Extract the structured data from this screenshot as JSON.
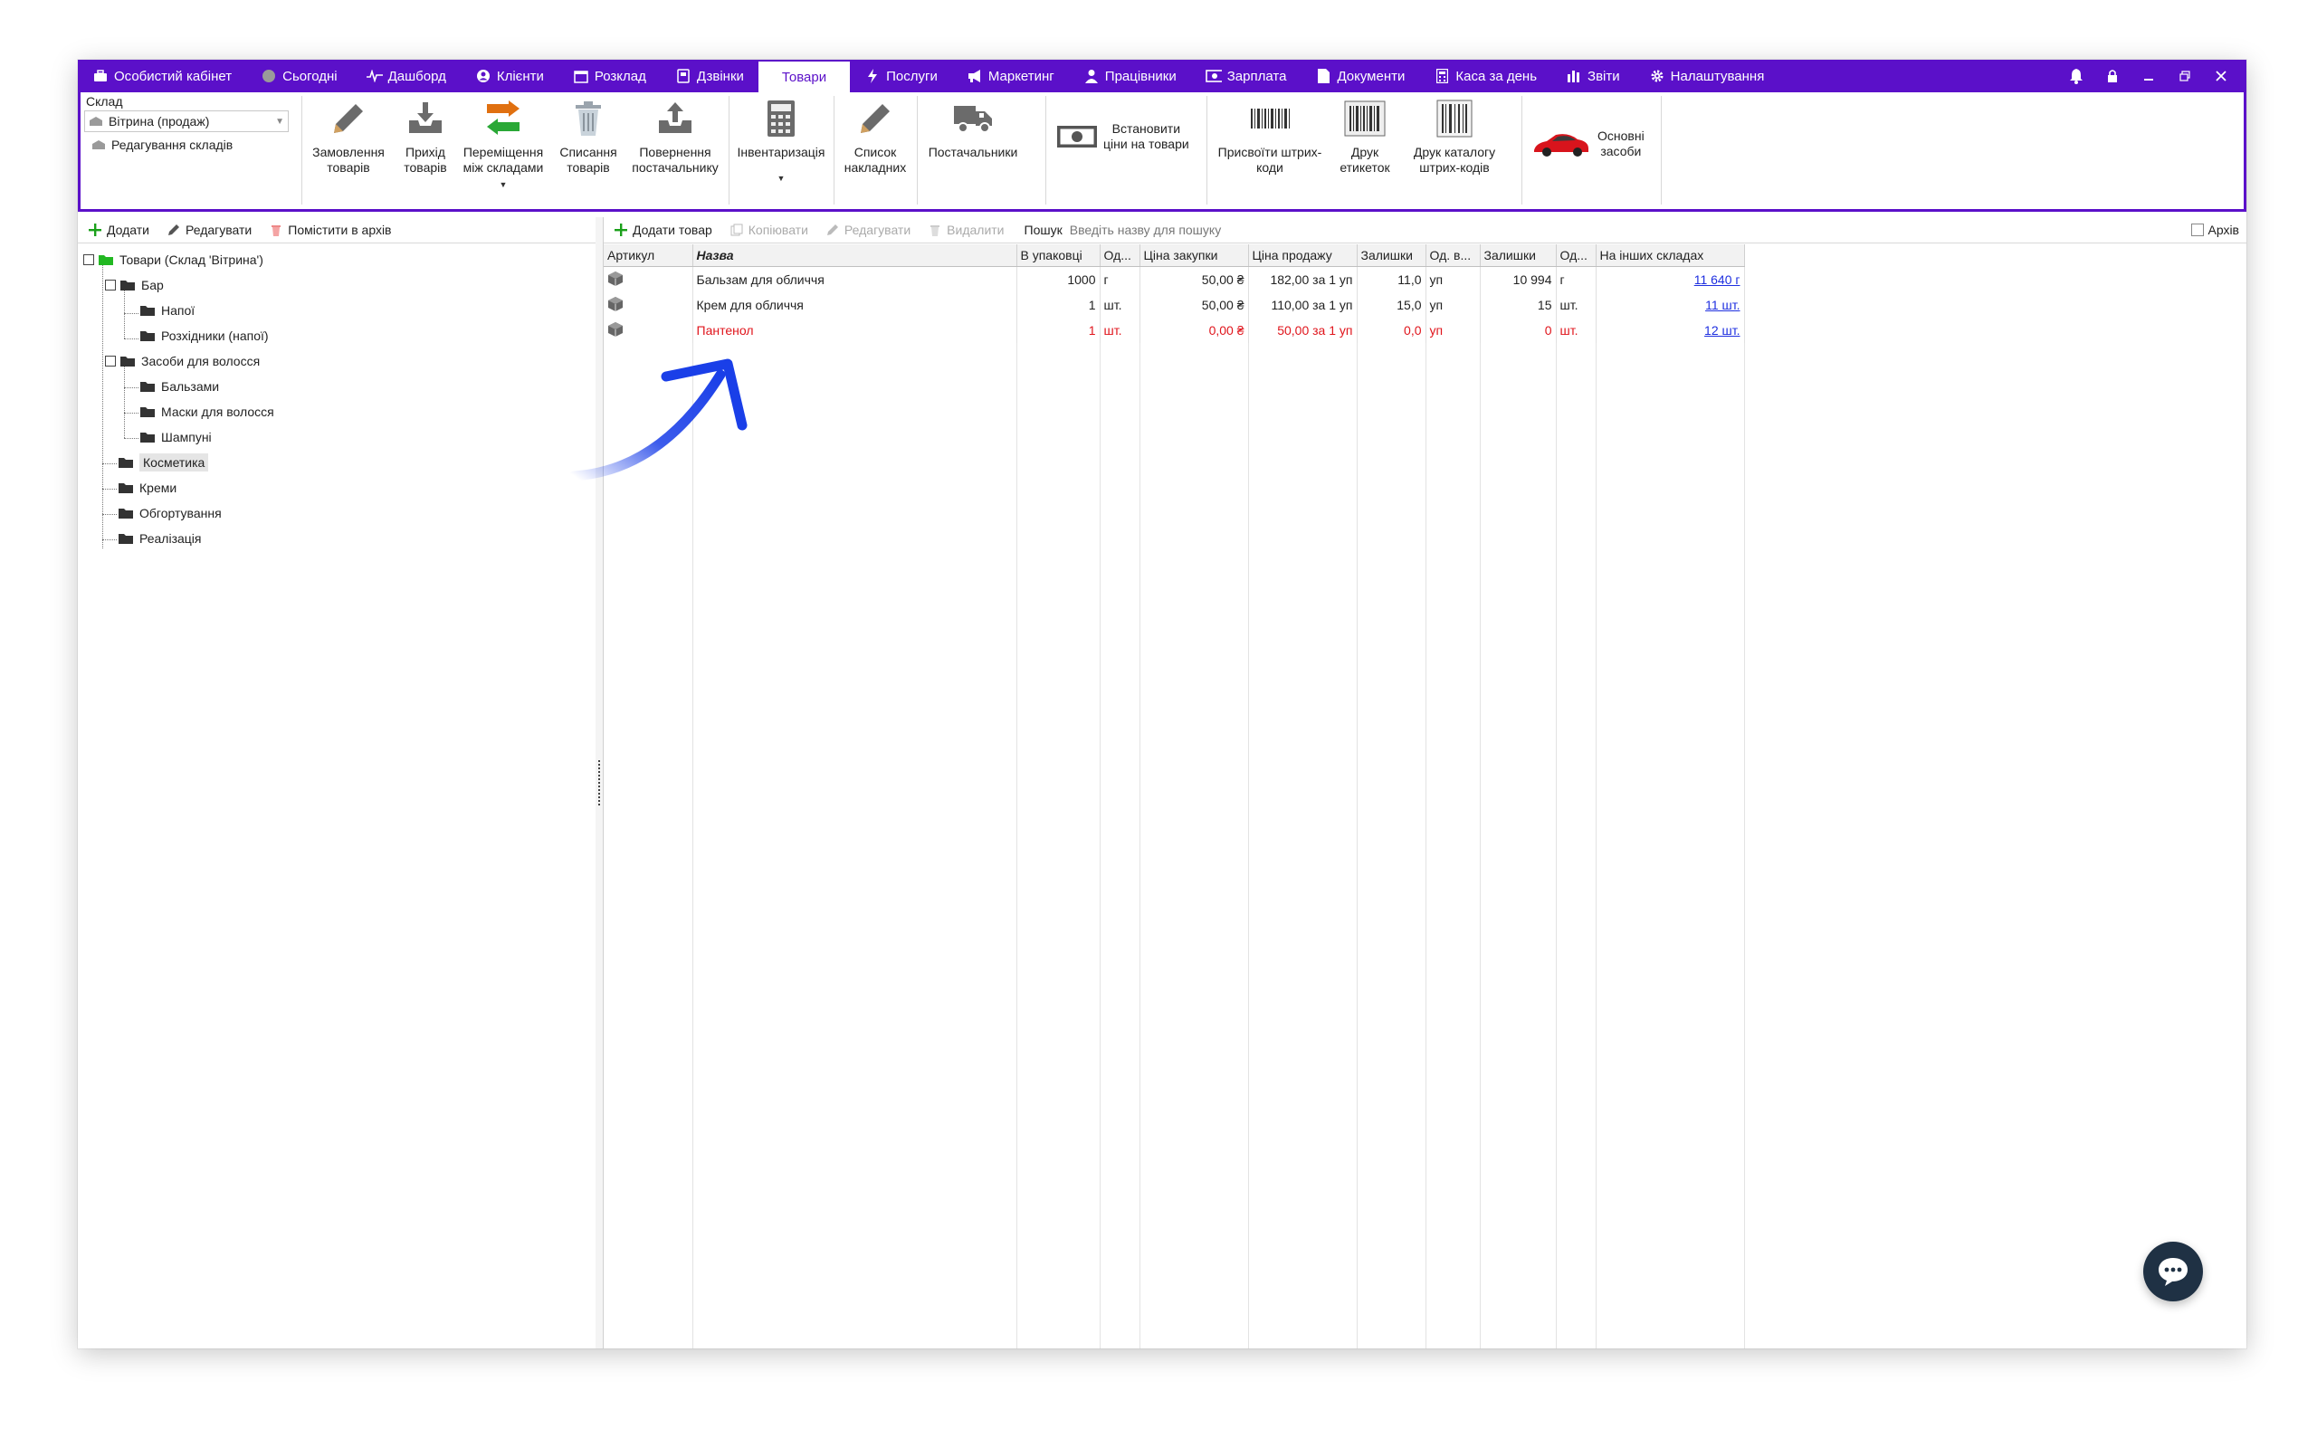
{
  "menu": {
    "items": [
      {
        "label": "Особистий кабінет",
        "icon": "cabinet-icon"
      },
      {
        "label": "Сьогодні",
        "icon": "today-icon"
      },
      {
        "label": "Дашборд",
        "icon": "pulse-icon"
      },
      {
        "label": "Клієнти",
        "icon": "user-circle-icon"
      },
      {
        "label": "Розклад",
        "icon": "calendar-icon"
      },
      {
        "label": "Дзвінки",
        "icon": "phone-icon"
      },
      {
        "label": "Товари",
        "icon": "",
        "active": true
      },
      {
        "label": "Послуги",
        "icon": "bolt-icon"
      },
      {
        "label": "Маркетинг",
        "icon": "megaphone-icon"
      },
      {
        "label": "Працівники",
        "icon": "person-icon"
      },
      {
        "label": "Зарплата",
        "icon": "money-icon"
      },
      {
        "label": "Документи",
        "icon": "document-icon"
      },
      {
        "label": "Каса за день",
        "icon": "calculator-icon"
      },
      {
        "label": "Звіти",
        "icon": "bar-chart-icon"
      },
      {
        "label": "Налаштування",
        "icon": "gear-icon"
      }
    ]
  },
  "ribbon": {
    "stock_label": "Склад",
    "stock_selected": "Вітрина (продаж)",
    "edit_stocks": "Редагування складів",
    "buttons": [
      {
        "l1": "Замовлення",
        "l2": "товарів"
      },
      {
        "l1": "Прихід",
        "l2": "товарів"
      },
      {
        "l1": "Переміщення",
        "l2": "між складами"
      },
      {
        "l1": "Списання",
        "l2": "товарів"
      },
      {
        "l1": "Повернення",
        "l2": "постачальнику"
      },
      {
        "l1": "Інвентаризація",
        "l2": ""
      },
      {
        "l1": "Список",
        "l2": "накладних"
      },
      {
        "l1": "Постачальники",
        "l2": ""
      },
      {
        "l1": "Встановити",
        "l2": "ціни на товари"
      },
      {
        "l1": "Присвоїти штрих-",
        "l2": "коди"
      },
      {
        "l1": "Друк",
        "l2": "етикеток"
      },
      {
        "l1": "Друк каталогу",
        "l2": "штрих-кодів"
      },
      {
        "l1": "Основні",
        "l2": "засоби"
      }
    ]
  },
  "left_toolbar": {
    "add": "Додати",
    "edit": "Редагувати",
    "archive": "Помістити в архів"
  },
  "tree": {
    "root": "Товари (Склад 'Вітрина')",
    "bar": "Бар",
    "drinks": "Напої",
    "consumables": "Розхідники (напої)",
    "hair": "Засоби для волосся",
    "balms": "Бальзами",
    "masks": "Маски для волосся",
    "shampoos": "Шампуні",
    "cosmetics": "Косметика",
    "creams": "Креми",
    "wraps": "Обгортування",
    "sales": "Реалізація"
  },
  "right_toolbar": {
    "add_product": "Додати товар",
    "copy": "Копіювати",
    "edit": "Редагувати",
    "delete": "Видалити",
    "search_label": "Пошук",
    "search_placeholder": "Введіть назву для пошуку",
    "archive": "Архів"
  },
  "table": {
    "headers": [
      "Артикул",
      "Назва",
      "В упаковці",
      "Од...",
      "Ціна закупки",
      "Ціна продажу",
      "Залишки",
      "Од. в...",
      "Залишки",
      "Од...",
      "На інших складах"
    ],
    "rows": [
      {
        "name": "Бальзам для обличчя",
        "pack": "1000",
        "unit": "г",
        "buy": "50,00 ₴",
        "sell": "182,00 за 1 уп",
        "rest": "11,0",
        "unit2": "уп",
        "rest2": "10 994",
        "unit3": "г",
        "other": "11 640 г",
        "highlight": false
      },
      {
        "name": "Крем для обличчя",
        "pack": "1",
        "unit": "шт.",
        "buy": "50,00 ₴",
        "sell": "110,00 за 1 уп",
        "rest": "15,0",
        "unit2": "уп",
        "rest2": "15",
        "unit3": "шт.",
        "other": "11 шт.",
        "highlight": false
      },
      {
        "name": "Пантенол",
        "pack": "1",
        "unit": "шт.",
        "buy": "0,00 ₴",
        "sell": "50,00 за 1 уп",
        "rest": "0,0",
        "unit2": "уп",
        "rest2": "0",
        "unit3": "шт.",
        "other": "12 шт.",
        "highlight": true
      }
    ]
  },
  "colors": {
    "accent": "#5b10c9",
    "arrow": "#1a3fe8",
    "warn_text": "#e0151c",
    "link": "#1e2fe0"
  }
}
